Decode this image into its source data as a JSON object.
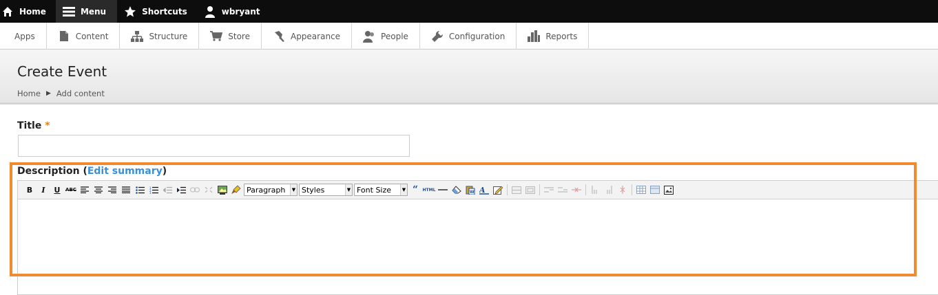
{
  "toolbar": {
    "home": "Home",
    "menu": "Menu",
    "shortcuts": "Shortcuts",
    "user": "wbryant"
  },
  "tray": {
    "items": [
      "Apps",
      "Content",
      "Structure",
      "Store",
      "Appearance",
      "People",
      "Configuration",
      "Reports"
    ]
  },
  "page": {
    "title": "Create Event",
    "breadcrumb": [
      "Home",
      "Add content"
    ]
  },
  "form": {
    "title_label": "Title",
    "required_mark": "*",
    "title_value": "",
    "description_label": "Description",
    "edit_summary": "Edit summary",
    "description_value": ""
  },
  "editor": {
    "bold": "B",
    "italic": "I",
    "underline": "U",
    "strike": "ABC",
    "format_select": "Paragraph",
    "styles_select": "Styles",
    "fontsize_select": "Font Size",
    "html_button": "HTML"
  },
  "colors": {
    "accent_highlight": "#f28a30",
    "link": "#3a8fd6",
    "required": "#e08020"
  }
}
